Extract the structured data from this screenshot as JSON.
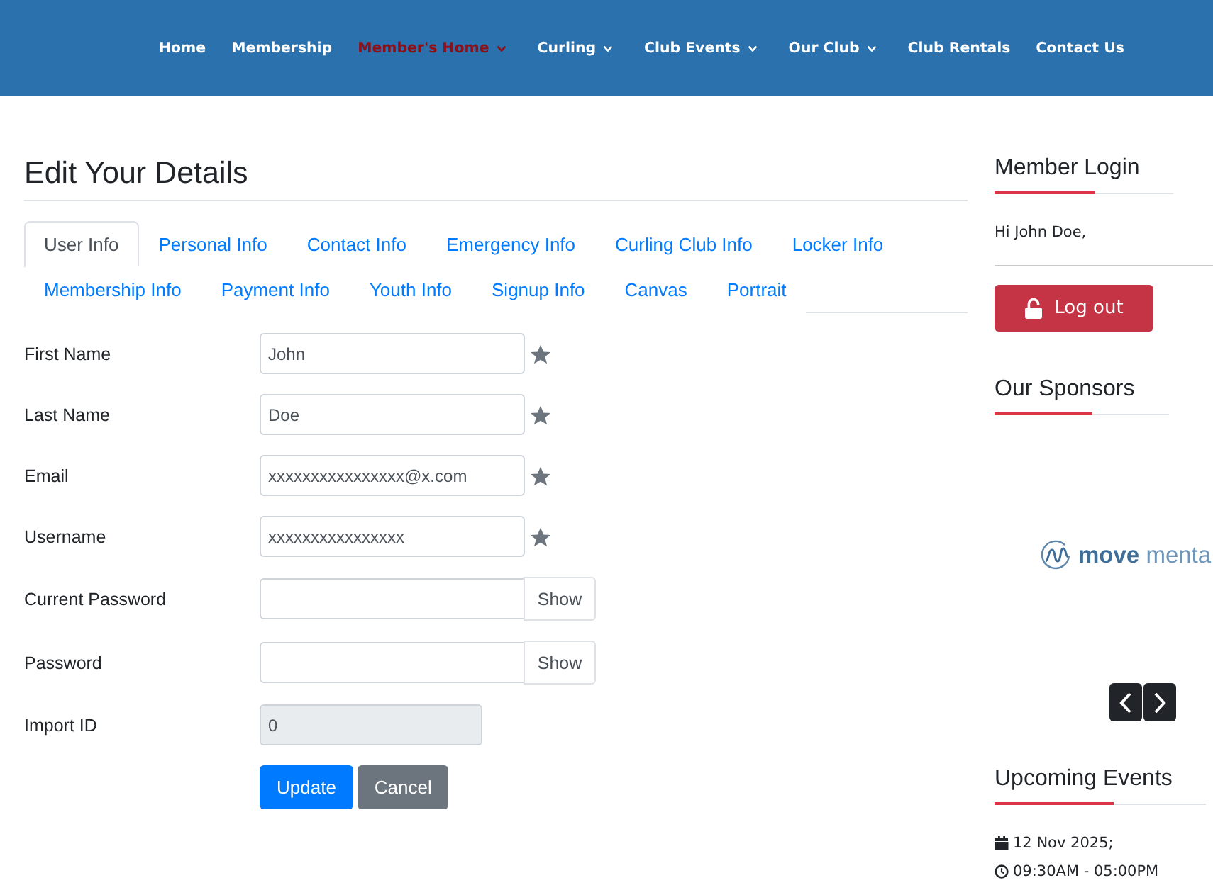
{
  "nav": [
    {
      "label": "Home",
      "selected": false,
      "has_menu": false
    },
    {
      "label": "Membership",
      "selected": false,
      "has_menu": false
    },
    {
      "label": "Member's Home",
      "selected": true,
      "has_menu": true
    },
    {
      "label": "Curling",
      "selected": false,
      "has_menu": true
    },
    {
      "label": "Club Events",
      "selected": false,
      "has_menu": true
    },
    {
      "label": "Our Club",
      "selected": false,
      "has_menu": true
    },
    {
      "label": "Club Rentals",
      "selected": false,
      "has_menu": false
    },
    {
      "label": "Contact Us",
      "selected": false,
      "has_menu": false
    }
  ],
  "page_title": "Edit Your Details",
  "tabs": [
    {
      "label": "User Info",
      "selected": true
    },
    {
      "label": "Personal Info",
      "selected": false
    },
    {
      "label": "Contact Info",
      "selected": false
    },
    {
      "label": "Emergency Info",
      "selected": false
    },
    {
      "label": "Curling Club Info",
      "selected": false
    },
    {
      "label": "Locker Info",
      "selected": false
    },
    {
      "label": "Membership Info",
      "selected": false
    },
    {
      "label": "Payment Info",
      "selected": false
    },
    {
      "label": "Youth Info",
      "selected": false
    },
    {
      "label": "Signup Info",
      "selected": false
    },
    {
      "label": "Canvas",
      "selected": false
    },
    {
      "label": "Portrait",
      "selected": false
    }
  ],
  "form": {
    "fields": [
      {
        "label": "First Name",
        "kind": "text",
        "value": "John",
        "required": true,
        "disabled": false
      },
      {
        "label": "Last Name",
        "kind": "text",
        "value": "Doe",
        "required": true,
        "disabled": false
      },
      {
        "label": "Email",
        "kind": "text",
        "value": "xxxxxxxxxxxxxxxx@x.com",
        "required": true,
        "disabled": false
      },
      {
        "label": "Username",
        "kind": "text",
        "value": "xxxxxxxxxxxxxxxx",
        "required": true,
        "disabled": false
      },
      {
        "label": "Current Password",
        "kind": "password",
        "button": "Show",
        "required": false,
        "disabled": false
      },
      {
        "label": "Password",
        "kind": "password",
        "button": "Show",
        "required": false,
        "disabled": false
      },
      {
        "label": "Import ID",
        "kind": "text",
        "value": "0",
        "required": false,
        "disabled": true
      }
    ],
    "buttons": [
      {
        "label": "Update",
        "kind": "primary"
      },
      {
        "label": "Cancel",
        "kind": "secondary"
      }
    ]
  },
  "sidebar": {
    "member_login": {
      "title": "Member Login",
      "greeting": "Hi John Doe,",
      "logout_button": "Log out"
    },
    "sponsors": {
      "title": "Our Sponsors",
      "logo": "**move** menta"
    },
    "upcoming_events": {
      "title": "Upcoming Events",
      "events": [
        {
          "date": "12 Nov 2025;",
          "time": "09:30AM - 05:00PM"
        }
      ]
    }
  }
}
